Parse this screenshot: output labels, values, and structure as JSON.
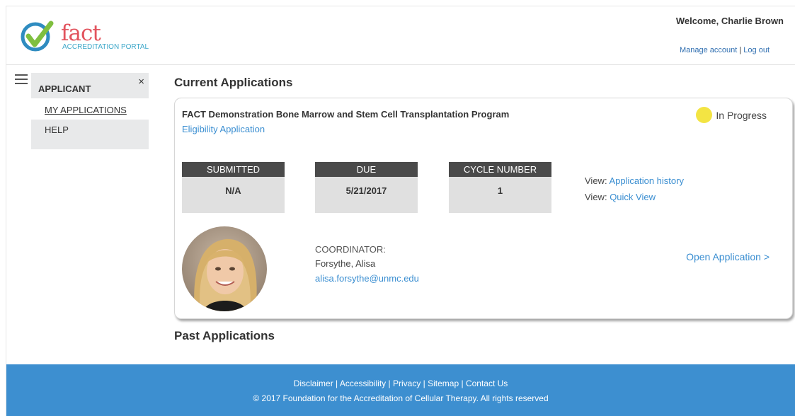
{
  "header": {
    "logo_word": "fact",
    "logo_sub": "ACCREDITATION PORTAL",
    "welcome": "Welcome, Charlie Brown",
    "manage_account": "Manage account",
    "separator": "|",
    "log_out": "Log out"
  },
  "side_menu": {
    "close": "×",
    "role": "APPLICANT",
    "items": [
      {
        "label": "MY APPLICATIONS",
        "active": true
      },
      {
        "label": "HELP",
        "active": false
      }
    ]
  },
  "main": {
    "current_title": "Current Applications",
    "past_title": "Past Applications",
    "application": {
      "program_name": "FACT Demonstration Bone Marrow and Stem Cell Transplantation Program",
      "type": "Eligibility Application",
      "status": "In Progress",
      "status_color": "#f3e443",
      "submitted_label": "SUBMITTED",
      "submitted_value": "N/A",
      "due_label": "DUE",
      "due_value": "5/21/2017",
      "cycle_label": "CYCLE NUMBER",
      "cycle_value": "1",
      "view_prefix": "View:",
      "view_history": "Application history",
      "view_quick": "Quick View",
      "coordinator_label": "COORDINATOR:",
      "coordinator_name": "Forsythe, Alisa",
      "coordinator_email": "alisa.forsythe@unmc.edu",
      "open_application": "Open Application >"
    }
  },
  "footer": {
    "links": [
      "Disclaimer",
      "Accessibility",
      "Privacy",
      "Sitemap",
      "Contact Us"
    ],
    "separator": " | ",
    "copyright": "© 2017 Foundation for the Accreditation of Cellular Therapy.  All rights reserved",
    "background": "#3d8fd0"
  },
  "colors": {
    "link": "#3a8ed1",
    "label_bg": "#4a4a4a",
    "box_bg": "#e0e0e0",
    "logo_red": "#e2545e",
    "logo_blue": "#3ca7c9"
  }
}
